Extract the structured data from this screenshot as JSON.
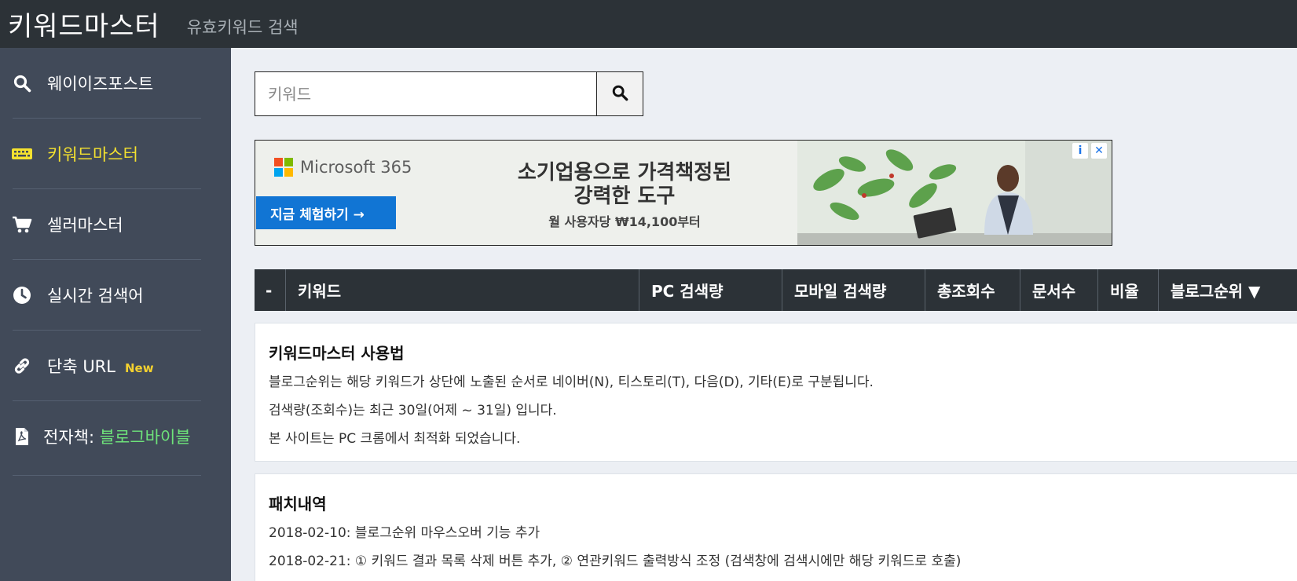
{
  "header": {
    "brand": "키워드마스터",
    "tagline": "유효키워드 검색"
  },
  "sidebar": {
    "items": [
      {
        "label": "웨이이즈포스트",
        "icon": "search-icon"
      },
      {
        "label": "키워드마스터",
        "icon": "keyboard-icon",
        "active": true
      },
      {
        "label": "셀러마스터",
        "icon": "cart-icon"
      },
      {
        "label": "실시간 검색어",
        "icon": "clock-icon"
      },
      {
        "label": "단축 URL",
        "badge": "New",
        "icon": "link-icon"
      },
      {
        "label": "전자책: ",
        "highlight": "블로그바이블",
        "icon": "pdf-file-icon"
      }
    ]
  },
  "search": {
    "placeholder": "키워드",
    "value": ""
  },
  "ad": {
    "brand": "Microsoft 365",
    "cta": "지금 체험하기 →",
    "headline_1": "소기업용으로 가격책정된",
    "headline_2": "강력한 도구",
    "sub": "월 사용자당 ₩14,100부터",
    "info_glyph": "i",
    "close_glyph": "✕",
    "logo_colors": [
      "#f25022",
      "#7fba00",
      "#00a4ef",
      "#ffb900"
    ]
  },
  "table": {
    "columns": [
      "-",
      "키워드",
      "PC 검색량",
      "모바일 검색량",
      "총조회수",
      "문서수",
      "비율",
      "블로그순위 ▼"
    ]
  },
  "usage": {
    "title": "키워드마스터 사용법",
    "lines": [
      "블로그순위는 해당 키워드가 상단에 노출된 순서로 네이버(N), 티스토리(T), 다음(D), 기타(E)로 구분됩니다.",
      "검색량(조회수)는 최근 30일(어제 ~ 31일) 입니다.",
      "본 사이트는 PC 크롬에서 최적화 되었습니다."
    ]
  },
  "patch": {
    "title": "패치내역",
    "lines": [
      "2018-02-10: 블로그순위 마우스오버 기능 추가",
      "2018-02-21: ① 키워드 결과 목록 삭제 버튼 추가, ② 연관키워드 출력방식 조정 (검색창에 검색시에만 해당 키워드로 호출)"
    ]
  },
  "colors": {
    "header_bg": "#2c3237",
    "sidebar_bg": "#414a59",
    "active": "#f4e12f",
    "accent_green": "#6ee37a",
    "cta_blue": "#1175d4"
  }
}
